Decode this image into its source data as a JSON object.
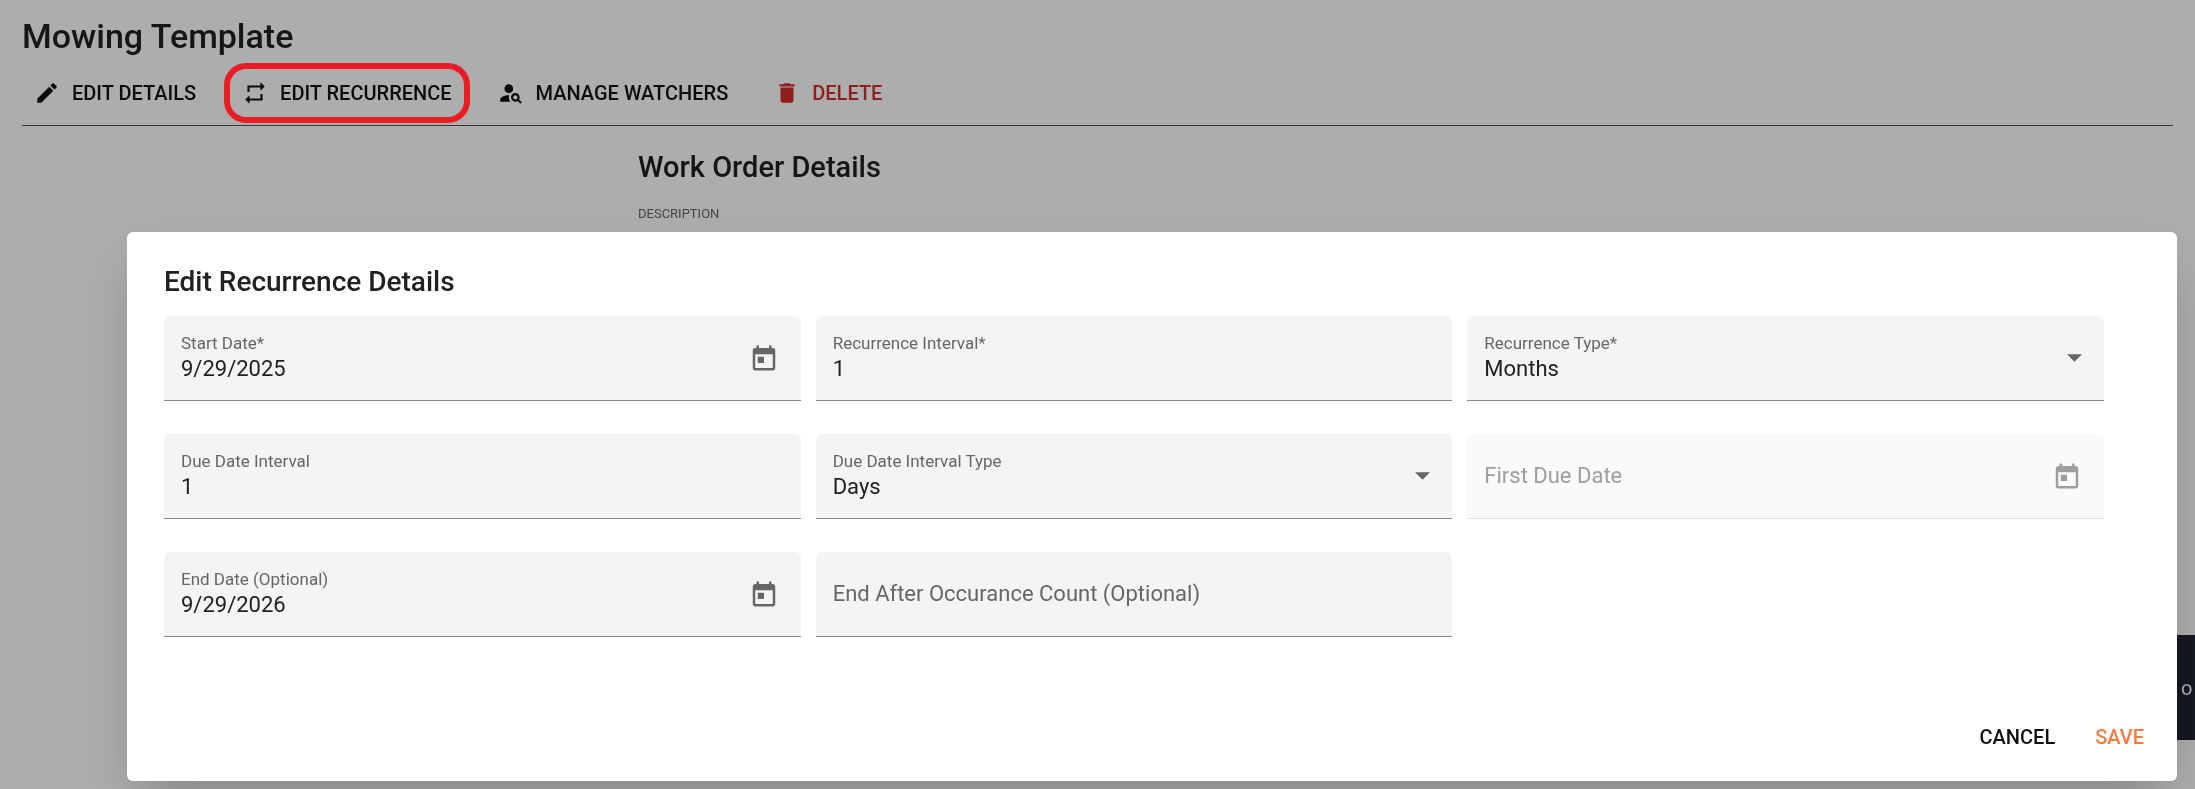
{
  "page": {
    "title": "Mowing Template",
    "toolbar": [
      {
        "kind": "edit",
        "label": "EDIT DETAILS",
        "highlighted": false,
        "danger": false
      },
      {
        "kind": "repeat",
        "label": "EDIT RECURRENCE",
        "highlighted": true,
        "danger": false
      },
      {
        "kind": "watchers",
        "label": "MANAGE WATCHERS",
        "highlighted": false,
        "danger": false
      },
      {
        "kind": "delete",
        "label": "DELETE",
        "highlighted": false,
        "danger": true
      }
    ],
    "section_title": "Work Order Details",
    "section_label": "DESCRIPTION",
    "side_button": "o"
  },
  "dialog": {
    "title": "Edit Recurrence Details",
    "fields": [
      {
        "kind": "date",
        "label": "Start Date*",
        "value": "9/29/2025",
        "disabled": false
      },
      {
        "kind": "text",
        "label": "Recurrence Interval*",
        "value": "1",
        "disabled": false
      },
      {
        "kind": "select",
        "label": "Recurrence Type*",
        "value": "Months",
        "disabled": false
      },
      {
        "kind": "text",
        "label": "Due Date Interval",
        "value": "1",
        "disabled": false
      },
      {
        "kind": "select",
        "label": "Due Date Interval Type",
        "value": "Days",
        "disabled": false
      },
      {
        "kind": "date",
        "label": "First Due Date",
        "disabled": true
      },
      {
        "kind": "date",
        "label": "End Date (Optional)",
        "value": "9/29/2026",
        "disabled": false
      },
      {
        "kind": "text",
        "label": "End After Occurance Count (Optional)",
        "disabled": false
      }
    ],
    "buttons": [
      {
        "kind": "cancel",
        "label": "CANCEL"
      },
      {
        "kind": "save",
        "label": "SAVE"
      }
    ]
  }
}
